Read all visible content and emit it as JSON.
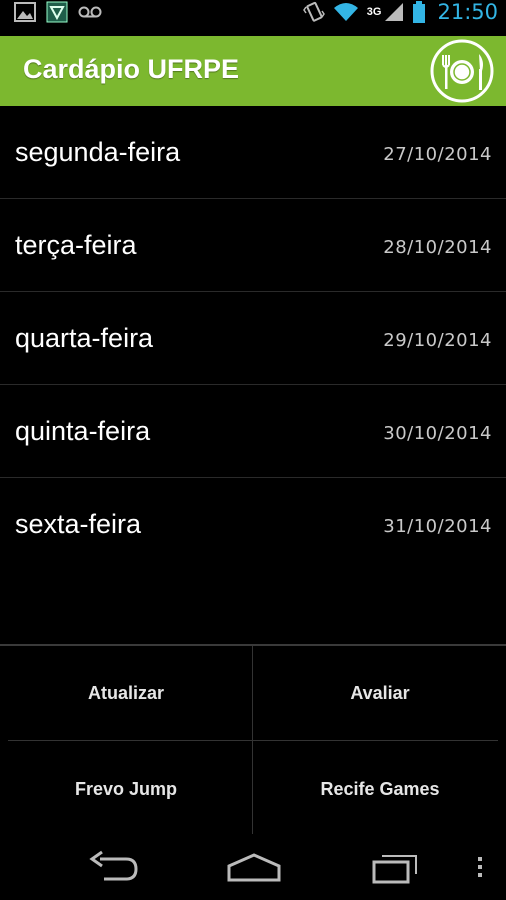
{
  "status_bar": {
    "time": "21:50",
    "network": "3G",
    "left_icons": [
      "image-icon",
      "shield-icon",
      "voicemail-icon"
    ],
    "right_icons": [
      "vibrate-icon",
      "wifi-icon",
      "signal-icon",
      "battery-icon"
    ]
  },
  "action_bar": {
    "title": "Cardápio UFRPE",
    "logo": "plate-utensils-icon",
    "background": "#7cb82f"
  },
  "days": [
    {
      "name": "segunda-feira",
      "date": "27/10/2014"
    },
    {
      "name": "terça-feira",
      "date": "28/10/2014"
    },
    {
      "name": "quarta-feira",
      "date": "29/10/2014"
    },
    {
      "name": "quinta-feira",
      "date": "30/10/2014"
    },
    {
      "name": "sexta-feira",
      "date": "31/10/2014"
    }
  ],
  "buttons": {
    "refresh": "Atualizar",
    "rate": "Avaliar",
    "frevo_jump": "Frevo Jump",
    "recife_games": "Recife Games"
  },
  "nav_bar": {
    "icons": [
      "back-icon",
      "home-icon",
      "recent-apps-icon",
      "overflow-menu-icon"
    ]
  }
}
